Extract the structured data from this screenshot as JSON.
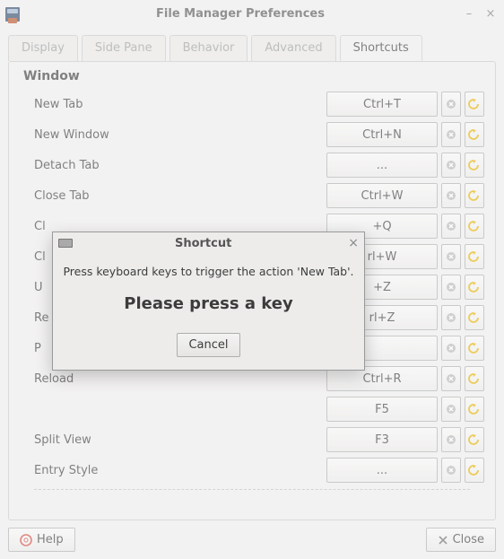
{
  "window": {
    "title": "File Manager Preferences"
  },
  "tabs": {
    "display": "Display",
    "sidepane": "Side Pane",
    "behavior": "Behavior",
    "advanced": "Advanced",
    "shortcuts": "Shortcuts"
  },
  "section": {
    "heading": "Window"
  },
  "rows": {
    "new_tab": {
      "label": "New Tab",
      "shortcut": "Ctrl+T"
    },
    "new_window": {
      "label": "New Window",
      "shortcut": "Ctrl+N"
    },
    "detach_tab": {
      "label": "Detach Tab",
      "shortcut": "..."
    },
    "close_tab": {
      "label": "Close Tab",
      "shortcut": "Ctrl+W"
    },
    "partial_q": {
      "label": "Cl",
      "shortcut": "+Q"
    },
    "partial_w": {
      "label": "Cl",
      "shortcut": "rl+W"
    },
    "undo": {
      "label": "U",
      "shortcut": "+Z"
    },
    "redo": {
      "label": "Re",
      "shortcut": "rl+Z"
    },
    "preferences": {
      "label": "P",
      "shortcut": ""
    },
    "reload": {
      "label": "Reload",
      "shortcut": "Ctrl+R"
    },
    "reload_alt": {
      "label": "",
      "shortcut": "F5"
    },
    "split_view": {
      "label": "Split View",
      "shortcut": "F3"
    },
    "entry_style": {
      "label": "Entry Style",
      "shortcut": "..."
    }
  },
  "buttons": {
    "help": "Help",
    "close": "Close"
  },
  "dialog": {
    "title": "Shortcut",
    "info": "Press keyboard keys to trigger the action 'New Tab'.",
    "emph": "Please press a key",
    "cancel": "Cancel"
  }
}
